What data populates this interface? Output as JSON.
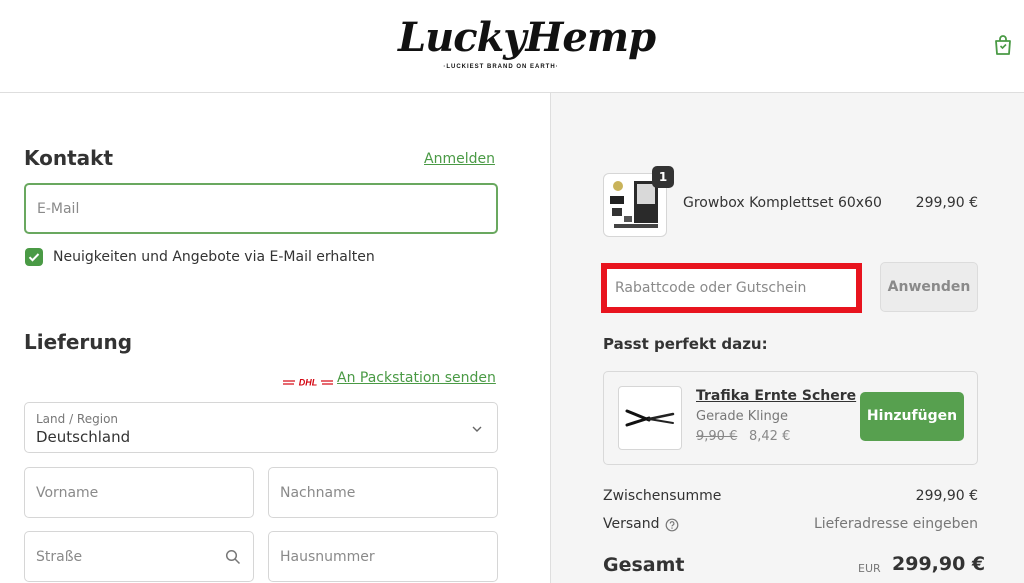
{
  "header": {
    "logo_text": "LuckyHemp",
    "logo_tagline": "·LUCKIEST BRAND ON EARTH·",
    "cart_icon": "shopping-bag-icon"
  },
  "contact": {
    "title": "Kontakt",
    "login_link": "Anmelden",
    "email_placeholder": "E-Mail",
    "newsletter_label": "Neuigkeiten und Angebote via E-Mail erhalten",
    "newsletter_checked": true
  },
  "delivery": {
    "title": "Lieferung",
    "dhl_logo": "DHL",
    "packstation_link": "An Packstation senden",
    "country_label": "Land / Region",
    "country_value": "Deutschland",
    "first_name_placeholder": "Vorname",
    "last_name_placeholder": "Nachname",
    "street_placeholder": "Straße",
    "house_number_placeholder": "Hausnummer"
  },
  "summary": {
    "product": {
      "name": "Growbox Komplettset 60x60",
      "price": "299,90 €",
      "quantity": "1"
    },
    "coupon_placeholder": "Rabattcode oder Gutschein",
    "apply_label": "Anwenden",
    "upsell_title": "Passt perfekt dazu:",
    "upsell": {
      "name": "Trafika Ernte Schere",
      "variant": "Gerade Klinge",
      "old_price": "9,90 €",
      "new_price": "8,42 €",
      "add_label": "Hinzufügen"
    },
    "subtotal_label": "Zwischensumme",
    "subtotal_value": "299,90 €",
    "shipping_label": "Versand",
    "shipping_value": "Lieferadresse eingeben",
    "total_label": "Gesamt",
    "total_currency": "EUR",
    "total_value": "299,90 €"
  },
  "colors": {
    "accent_green": "#4a9a45",
    "button_green": "#57a04f",
    "highlight_red": "#e8141e",
    "summary_bg": "#f5f5f5"
  }
}
